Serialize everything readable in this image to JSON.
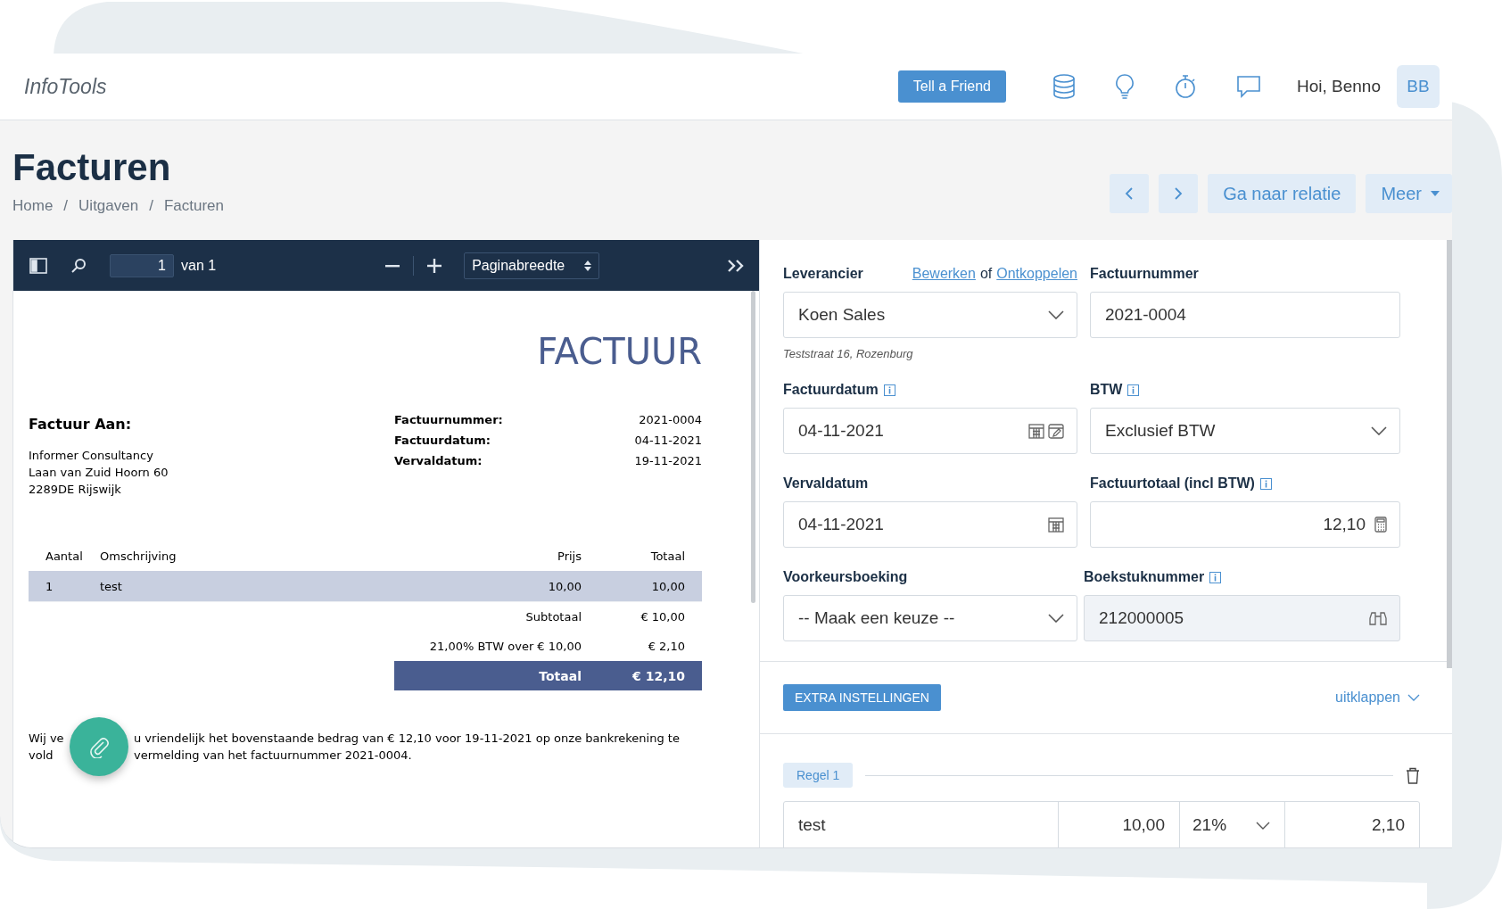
{
  "header": {
    "logo": "InfoTools",
    "tell_friend": "Tell a Friend",
    "greeting": "Hoi, Benno",
    "avatar": "BB"
  },
  "page": {
    "title": "Facturen",
    "breadcrumb": [
      "Home",
      "Uitgaven",
      "Facturen"
    ],
    "breadcrumb_separator": "/",
    "actions": [
      "Ga naar relatie",
      "Meer"
    ]
  },
  "viewer": {
    "page_number": "1",
    "page_of": "van 1",
    "zoom": "Paginabreedte"
  },
  "document": {
    "title": "FACTUUR",
    "bill_to_heading": "Factuur Aan:",
    "address": [
      "Informer Consultancy",
      "Laan van Zuid Hoorn 60",
      "2289DE Rijswijk"
    ],
    "meta": [
      {
        "label": "Factuurnummer:",
        "value": "2021-0004"
      },
      {
        "label": "Factuurdatum:",
        "value": "04-11-2021"
      },
      {
        "label": "Vervaldatum:",
        "value": "19-11-2021"
      }
    ],
    "columns": [
      "Aantal",
      "Omschrijving",
      "Prijs",
      "Totaal"
    ],
    "rows": [
      [
        "1",
        "test",
        "10,00",
        "10,00"
      ]
    ],
    "subtotal_label": "Subtotaal",
    "subtotal": "€ 10,00",
    "vat_label": "21,00% BTW over € 10,00",
    "vat": "€ 2,10",
    "total_label": "Totaal",
    "total": "€ 12,10",
    "note_lines": [
      [
        "Wij ve",
        "u vriendelijk het bovenstaande bedrag van € 12,10 voor 19-11-2021 op onze bankrekening te"
      ],
      [
        "vold",
        "vermelding van het factuurnummer 2021-0004."
      ]
    ]
  },
  "form": {
    "supplier": {
      "label": "Leverancier",
      "edit_link": "Bewerken",
      "or_text": "of",
      "unlink_link": "Ontkoppelen",
      "value": "Koen Sales",
      "address": "Teststraat 16, Rozenburg"
    },
    "fields": [
      {
        "label": "Factuurnummer",
        "value": "2021-0004",
        "kind": "text",
        "info": false,
        "disabled": false
      },
      {
        "label": "Factuurdatum",
        "value": "04-11-2021",
        "kind": "date-edit",
        "info": true,
        "disabled": false
      },
      {
        "label": "BTW",
        "value": "Exclusief BTW",
        "kind": "select",
        "info": true,
        "disabled": false
      },
      {
        "label": "Vervaldatum",
        "value": "04-11-2021",
        "kind": "date",
        "info": false,
        "disabled": false
      },
      {
        "label": "Factuurtotaal (incl BTW)",
        "value": "12,10",
        "kind": "number",
        "info": true,
        "disabled": false
      },
      {
        "label": "Voorkeursboeking",
        "value": "-- Maak een keuze --",
        "kind": "select",
        "info": false,
        "disabled": false
      },
      {
        "label": "Boekstuknummer",
        "value": "212000005",
        "kind": "lookup",
        "info": true,
        "disabled": true
      }
    ],
    "extra_button": "EXTRA INSTELLINGEN",
    "expand_link": "uitklappen",
    "line": {
      "badge": "Regel 1",
      "description": "test",
      "price": "10,00",
      "vat": "21%",
      "amount": "2,10"
    }
  }
}
